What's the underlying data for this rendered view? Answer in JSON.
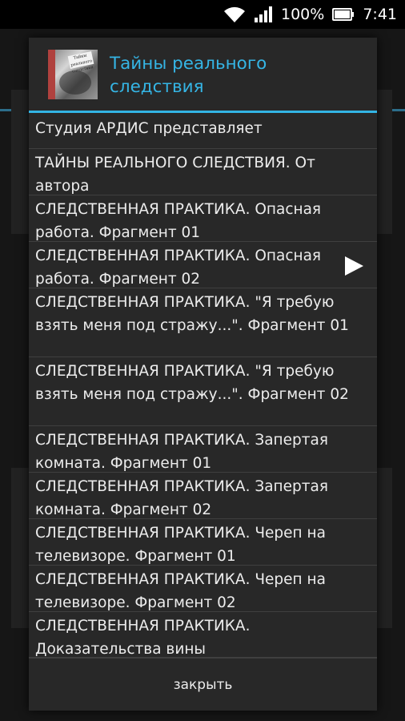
{
  "status_bar": {
    "battery_percent": "100%",
    "time": "7:41",
    "icons": [
      "wifi-icon",
      "signal-icon",
      "battery-icon"
    ]
  },
  "dialog": {
    "title": "Тайны реального следствия",
    "cover_text": "Тайны реального следствия",
    "tracks": [
      "Студия АРДИС представляет",
      "ТАЙНЫ РЕАЛЬНОГО СЛЕДСТВИЯ. От автора",
      "СЛЕДСТВЕННАЯ ПРАКТИКА. Опасная работа. Фрагмент 01",
      "СЛЕДСТВЕННАЯ ПРАКТИКА. Опасная работа. Фрагмент 02",
      "СЛЕДСТВЕННАЯ ПРАКТИКА. \"Я требую взять меня под стражу...\". Фрагмент 01",
      "СЛЕДСТВЕННАЯ ПРАКТИКА. \"Я требую взять меня под стражу...\". Фрагмент 02",
      "СЛЕДСТВЕННАЯ ПРАКТИКА. Запертая комната. Фрагмент 01",
      "СЛЕДСТВЕННАЯ ПРАКТИКА. Запертая комната. Фрагмент 02",
      "СЛЕДСТВЕННАЯ ПРАКТИКА. Череп на телевизоре. Фрагмент 01",
      "СЛЕДСТВЕННАЯ ПРАКТИКА. Череп на телевизоре. Фрагмент 02",
      "СЛЕДСТВЕННАЯ ПРАКТИКА. Доказательства вины"
    ],
    "close_label": "закрыть"
  },
  "colors": {
    "accent": "#33b5e5",
    "dialog_bg": "#282828",
    "text": "#ececec"
  }
}
